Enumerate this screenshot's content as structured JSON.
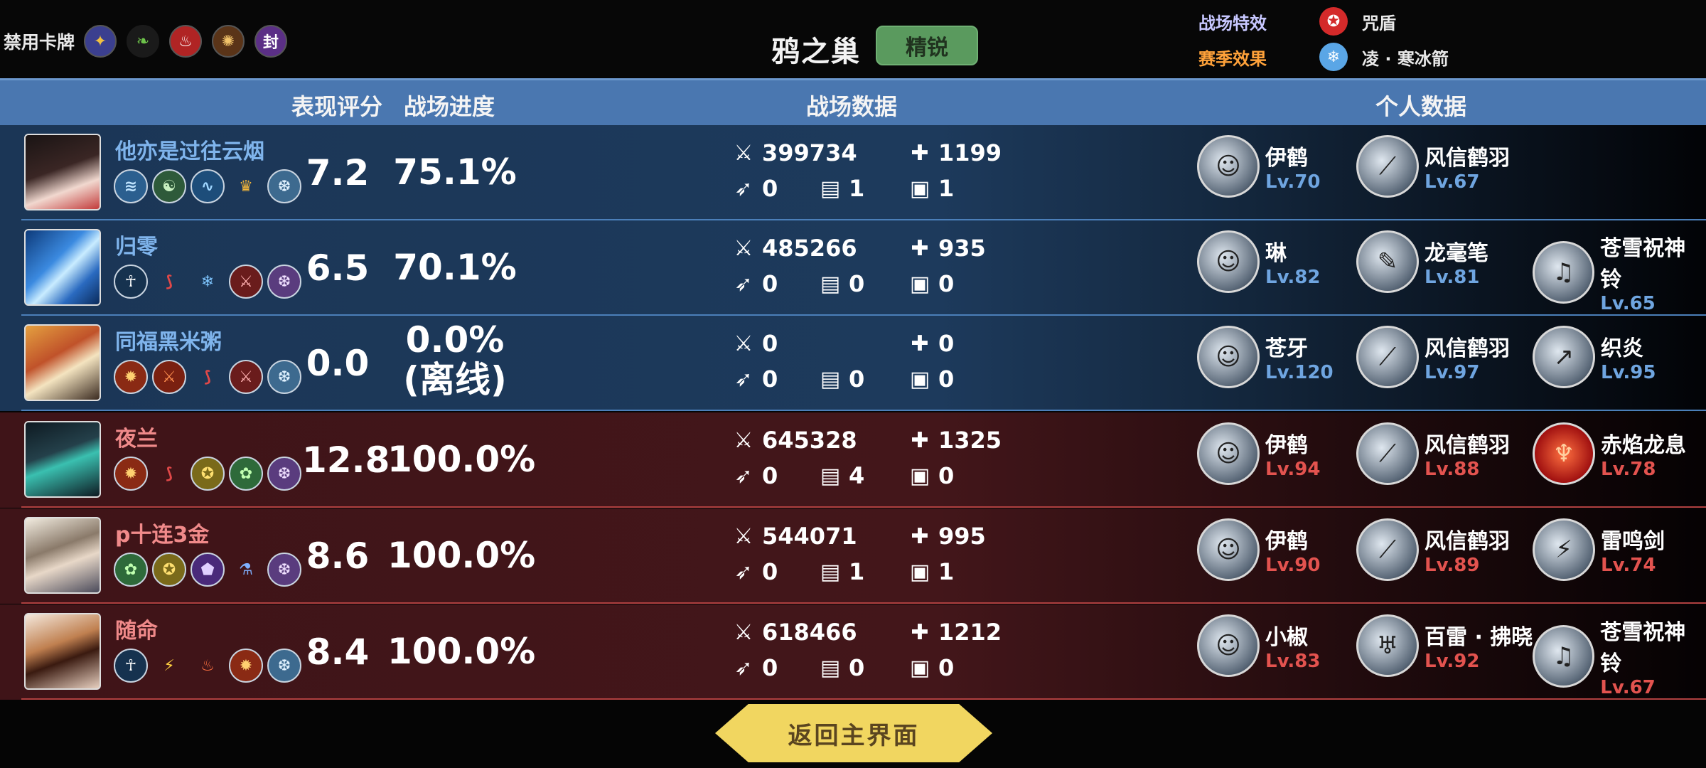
{
  "topbar": {
    "ban_label": "禁用卡牌",
    "banned_cards": [
      {
        "icon": "banned-card-1-icon",
        "glyph": "✦",
        "color": "#3b3f8f"
      },
      {
        "icon": "banned-card-2-icon",
        "glyph": "❧",
        "color": "#1a1a1a"
      },
      {
        "icon": "banned-card-3-icon",
        "glyph": "♨",
        "color": "#b02424"
      },
      {
        "icon": "banned-card-4-icon",
        "glyph": "✺",
        "color": "#5a3418"
      },
      {
        "icon": "banned-card-5-icon",
        "glyph": "封",
        "color": "#5b2f86"
      }
    ],
    "map_name": "鸦之巢",
    "difficulty": "精锐",
    "battlefield_effect_label": "战场特效",
    "battlefield_effect_value": "咒盾",
    "season_effect_label": "赛季效果",
    "season_effect_value": "凌 · 寒冰箭",
    "battlefield_effect_color": "#c7c7ff",
    "season_effect_color": "#ffa23a"
  },
  "header": {
    "score": "表现评分",
    "progress": "战场进度",
    "battle_data": "战场数据",
    "personal_data": "个人数据"
  },
  "players": [
    {
      "team": "blue",
      "name": "他亦是过往云烟",
      "score": "7.2",
      "progress": "75.1%",
      "progress_note": "",
      "damage": "399734",
      "healing": "1199",
      "kills": "0",
      "cards": "1",
      "chests": "1",
      "hero": {
        "name": "伊鹤",
        "level": "Lv.70"
      },
      "weapon1": {
        "name": "风信鹤羽",
        "level": "Lv.67"
      },
      "weapon2": {
        "name": "",
        "level": ""
      }
    },
    {
      "team": "blue",
      "name": "归零",
      "score": "6.5",
      "progress": "70.1%",
      "progress_note": "",
      "damage": "485266",
      "healing": "935",
      "kills": "0",
      "cards": "0",
      "chests": "0",
      "hero": {
        "name": "琳",
        "level": "Lv.82"
      },
      "weapon1": {
        "name": "龙毫笔",
        "level": "Lv.81"
      },
      "weapon2": {
        "name": "苍雪祝神铃",
        "level": "Lv.65"
      }
    },
    {
      "team": "blue",
      "name": "同福黑米粥",
      "score": "0.0",
      "progress": "0.0%",
      "progress_note": "(离线)",
      "damage": "0",
      "healing": "0",
      "kills": "0",
      "cards": "0",
      "chests": "0",
      "hero": {
        "name": "苍牙",
        "level": "Lv.120"
      },
      "weapon1": {
        "name": "风信鹤羽",
        "level": "Lv.97"
      },
      "weapon2": {
        "name": "织炎",
        "level": "Lv.95"
      }
    },
    {
      "team": "red",
      "name": "夜兰",
      "score": "12.8",
      "progress": "100.0%",
      "progress_note": "",
      "damage": "645328",
      "healing": "1325",
      "kills": "0",
      "cards": "4",
      "chests": "0",
      "hero": {
        "name": "伊鹤",
        "level": "Lv.94"
      },
      "weapon1": {
        "name": "风信鹤羽",
        "level": "Lv.88"
      },
      "weapon2": {
        "name": "赤焰龙息",
        "level": "Lv.78"
      }
    },
    {
      "team": "red",
      "name": "p十连3金",
      "score": "8.6",
      "progress": "100.0%",
      "progress_note": "",
      "damage": "544071",
      "healing": "995",
      "kills": "0",
      "cards": "1",
      "chests": "1",
      "hero": {
        "name": "伊鹤",
        "level": "Lv.90"
      },
      "weapon1": {
        "name": "风信鹤羽",
        "level": "Lv.89"
      },
      "weapon2": {
        "name": "雷鸣剑",
        "level": "Lv.74"
      }
    },
    {
      "team": "red",
      "name": "随命",
      "score": "8.4",
      "progress": "100.0%",
      "progress_note": "",
      "damage": "618466",
      "healing": "1212",
      "kills": "0",
      "cards": "0",
      "chests": "0",
      "hero": {
        "name": "小椒",
        "level": "Lv.83"
      },
      "weapon1": {
        "name": "百雷 · 拂晓",
        "level": "Lv.92"
      },
      "weapon2": {
        "name": "苍雪祝神铃",
        "level": "Lv.67"
      }
    }
  ],
  "colors": {
    "blue_team": "#1d3a5c",
    "red_team": "#43161a",
    "header": "#4a77b0",
    "accent_gold": "#f1d660"
  },
  "back_button": "返回主界面"
}
